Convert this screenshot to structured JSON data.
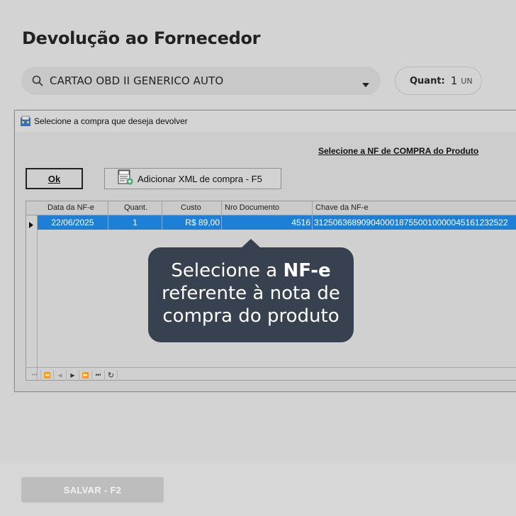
{
  "page": {
    "title": "Devolução ao Fornecedor",
    "product_select": {
      "value": "CARTAO OBD II GENERICO AUTO",
      "icon": "search-icon"
    },
    "quantity": {
      "label": "Quant:",
      "value": "1",
      "unit": "UN"
    },
    "save_button": {
      "label": "SALVAR - F2"
    }
  },
  "dialog": {
    "title": "Selecione a compra que deseja devolver",
    "nf_link": "Selecione a NF de COMPRA do Produto",
    "ok_button": "Ok",
    "xml_button": "Adicionar XML de compra - F5",
    "grid": {
      "columns": [
        "Data da NF-e",
        "Quant.",
        "Custo",
        "Nro Documento",
        "Chave da NF-e"
      ],
      "rows": [
        {
          "data": "22/06/2025",
          "quant": "1",
          "custo": "R$ 89,00",
          "nro": "4516",
          "chave": "31250636890904000187550010000045161232522"
        }
      ]
    }
  },
  "tooltip": {
    "line1_pre": "Selecione a ",
    "line1_bold": "NF-e",
    "line2": "referente à nota de",
    "line3": "compra do produto"
  },
  "colors": {
    "selection": "#1e7fd6",
    "tooltip_bg": "#374150",
    "background": "#d3d3d3"
  }
}
